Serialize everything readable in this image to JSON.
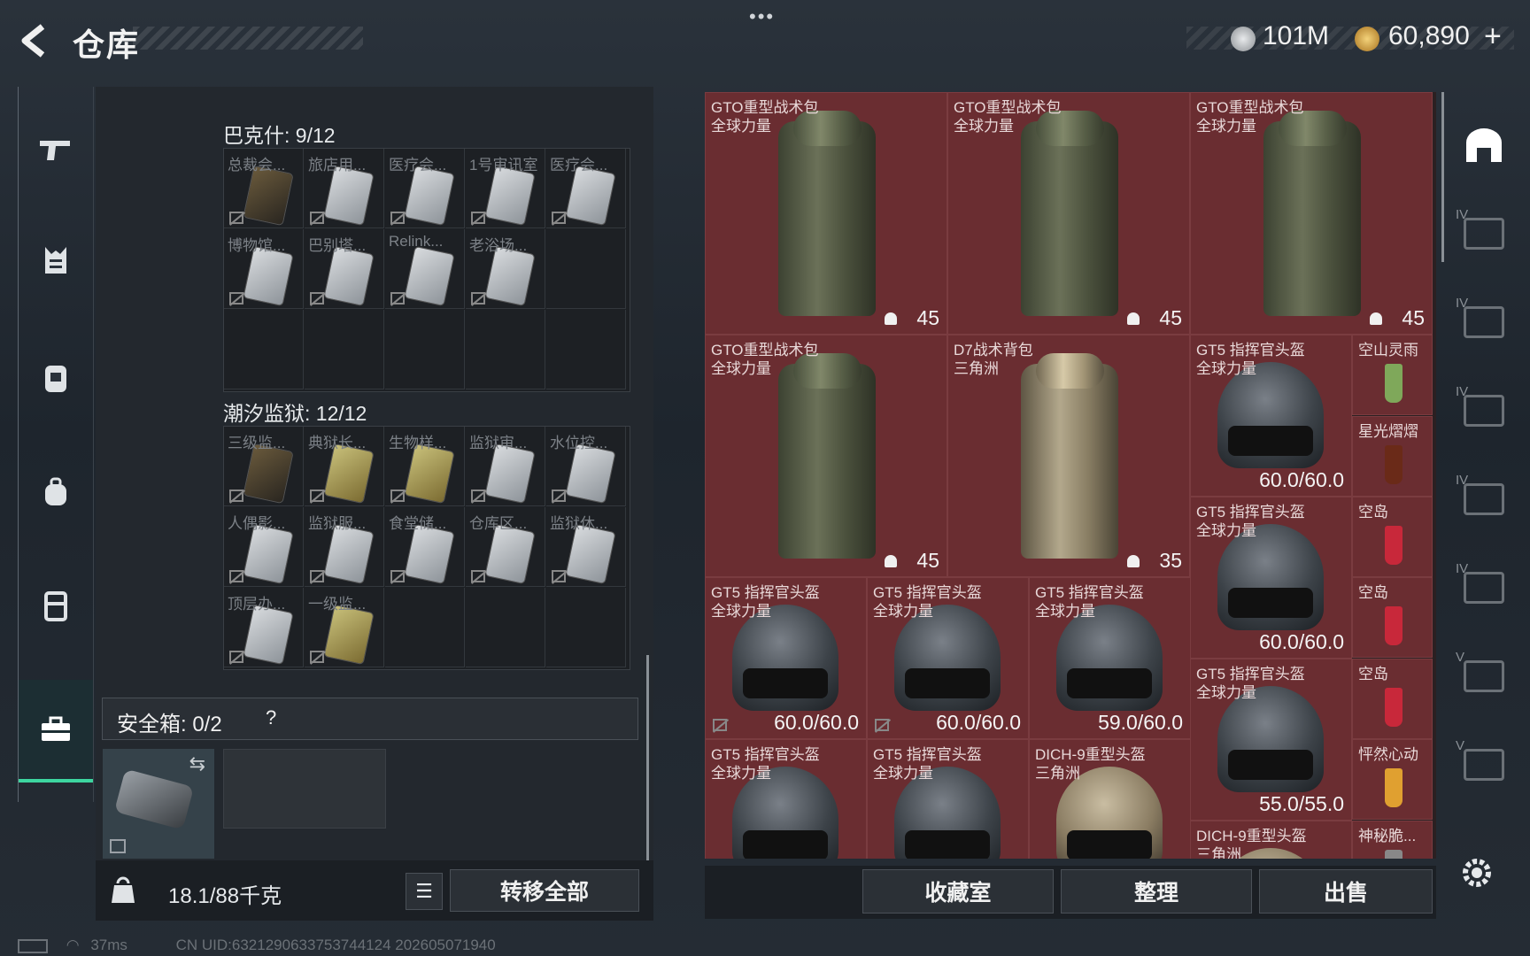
{
  "header": {
    "title": "仓库",
    "menu_dots": "•••"
  },
  "currency": [
    {
      "name": "silver-coin-icon",
      "value": "101M",
      "color": "#c9ccd0"
    },
    {
      "name": "gold-coin-icon",
      "value": "60,890",
      "color": "#d9a640"
    }
  ],
  "add_label": "+",
  "left_nav": [
    "pistol-icon",
    "armor-vest-icon",
    "chest-rig-icon",
    "backpack-icon",
    "container-icon",
    "briefcase-icon"
  ],
  "bakeshi": {
    "label": "巴克什: 9/12",
    "cells": [
      {
        "name": "总裁会...",
        "style": "dark"
      },
      {
        "name": "旅店用...",
        "style": "light"
      },
      {
        "name": "医疗会...",
        "style": "light"
      },
      {
        "name": "1号审讯室",
        "style": "light"
      },
      {
        "name": "医疗会...",
        "style": "light"
      },
      {
        "name": "博物馆...",
        "style": "light"
      },
      {
        "name": "巴别塔...",
        "style": "light"
      },
      {
        "name": "Relink...",
        "style": "light"
      },
      {
        "name": "老浴场...",
        "style": "light"
      }
    ]
  },
  "prison": {
    "label": "潮汐监狱: 12/12",
    "cells": [
      {
        "name": "三级监...",
        "style": "dark"
      },
      {
        "name": "典狱长...",
        "style": "gold"
      },
      {
        "name": "生物样...",
        "style": "gold"
      },
      {
        "name": "监狱审...",
        "style": "light"
      },
      {
        "name": "水位控...",
        "style": "light"
      },
      {
        "name": "人偶影...",
        "style": "light"
      },
      {
        "name": "监狱服...",
        "style": "light"
      },
      {
        "name": "食堂储...",
        "style": "light"
      },
      {
        "name": "仓库区...",
        "style": "light"
      },
      {
        "name": "监狱休...",
        "style": "light"
      },
      {
        "name": "顶层办...",
        "style": "light"
      },
      {
        "name": "一级监...",
        "style": "gold"
      }
    ]
  },
  "safebox": {
    "label": "安全箱: 0/2",
    "help": "?"
  },
  "footer_left": {
    "weight": "18.1/88千克",
    "transfer_all": "转移全部"
  },
  "inventory": {
    "backpacks": [
      {
        "name": "GTO重型战术包",
        "sub": "全球力量",
        "weight": "45"
      },
      {
        "name": "GTO重型战术包",
        "sub": "全球力量",
        "weight": "45"
      },
      {
        "name": "GTO重型战术包",
        "sub": "全球力量",
        "weight": "45"
      },
      {
        "name": "GTO重型战术包",
        "sub": "全球力量",
        "weight": "45"
      },
      {
        "name": "D7战术背包",
        "sub": "三角洲",
        "weight": "35"
      }
    ],
    "helmets": [
      {
        "name": "GT5 指挥官头盔",
        "sub": "全球力量",
        "dur": "60.0/60.0"
      },
      {
        "name": "GT5 指挥官头盔",
        "sub": "全球力量",
        "dur": "60.0/60.0"
      },
      {
        "name": "GT5 指挥官头盔",
        "sub": "全球力量",
        "dur": "55.0/55.0"
      },
      {
        "name": "GT5 指挥官头盔",
        "sub": "全球力量",
        "dur": "60.0/60.0"
      },
      {
        "name": "GT5 指挥官头盔",
        "sub": "全球力量",
        "dur": "60.0/60.0"
      },
      {
        "name": "GT5 指挥官头盔",
        "sub": "全球力量",
        "dur": "59.0/60.0"
      },
      {
        "name": "GT5 指挥官头盔",
        "sub": "全球力量",
        "dur": ""
      },
      {
        "name": "GT5 指挥官头盔",
        "sub": "全球力量",
        "dur": ""
      },
      {
        "name": "DICH-9重型头盔",
        "sub": "三角洲",
        "dur": ""
      },
      {
        "name": "DICH-9重型头盔",
        "sub": "三角洲",
        "dur": ""
      }
    ],
    "drinks": [
      {
        "name": "空山灵雨",
        "color": "#7fa85a"
      },
      {
        "name": "星光熠熠",
        "color": "#6a2a18"
      },
      {
        "name": "空岛",
        "color": "#c8283a"
      },
      {
        "name": "空岛",
        "color": "#c8283a"
      },
      {
        "name": "空岛",
        "color": "#c8283a"
      },
      {
        "name": "怦然心动",
        "color": "#e0a030"
      },
      {
        "name": "神秘脆...",
        "color": "#888888"
      }
    ]
  },
  "footer_right": {
    "collection": "收藏室",
    "sort": "整理",
    "sell": "出售"
  },
  "right_nav_tiers": [
    "IV",
    "IV",
    "IV",
    "IV",
    "IV",
    "V",
    "V"
  ],
  "status": {
    "ping": "37ms",
    "uid": "CN UID:6321290633753744124 202605071940"
  }
}
